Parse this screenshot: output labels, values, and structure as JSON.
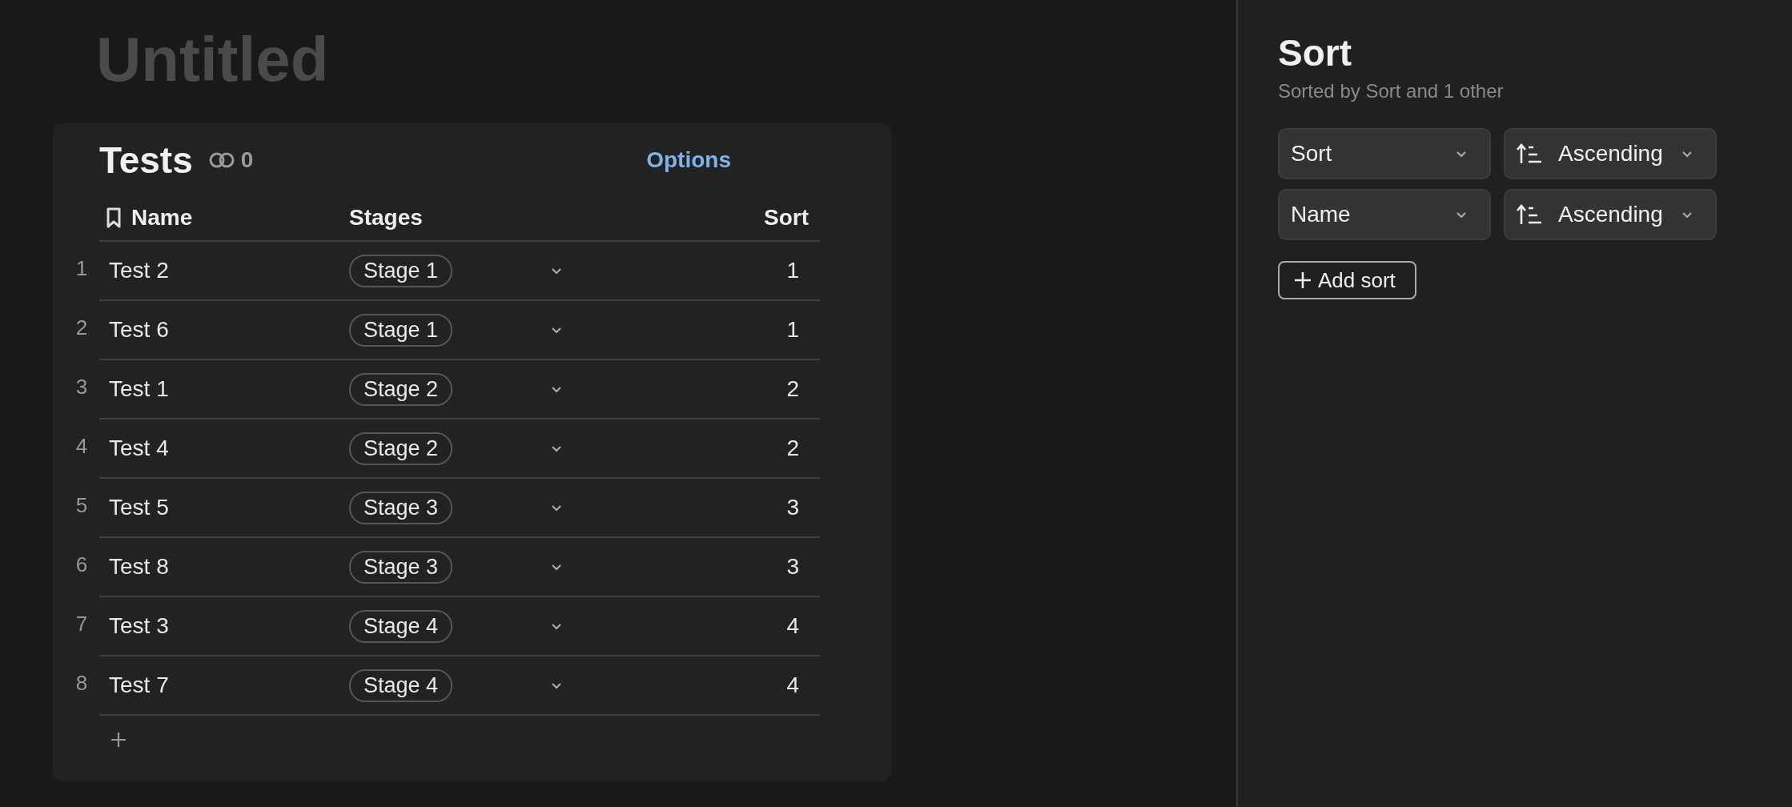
{
  "page": {
    "title": "Untitled"
  },
  "table": {
    "title": "Tests",
    "link_count": "0",
    "options": "Options",
    "columns": [
      "Name",
      "Stages",
      "Sort"
    ],
    "rows": [
      {
        "number": "1",
        "name": "Test 2",
        "stage": "Stage 1",
        "sort": "1"
      },
      {
        "number": "2",
        "name": "Test 6",
        "stage": "Stage 1",
        "sort": "1"
      },
      {
        "number": "3",
        "name": "Test 1",
        "stage": "Stage 2",
        "sort": "2"
      },
      {
        "number": "4",
        "name": "Test 4",
        "stage": "Stage 2",
        "sort": "2"
      },
      {
        "number": "5",
        "name": "Test 5",
        "stage": "Stage 3",
        "sort": "3"
      },
      {
        "number": "6",
        "name": "Test 8",
        "stage": "Stage 3",
        "sort": "3"
      },
      {
        "number": "7",
        "name": "Test 3",
        "stage": "Stage 4",
        "sort": "4"
      },
      {
        "number": "8",
        "name": "Test 7",
        "stage": "Stage 4",
        "sort": "4"
      }
    ]
  },
  "sort_panel": {
    "title": "Sort",
    "subtitle": "Sorted by Sort and 1 other",
    "sorts": [
      {
        "field": "Sort",
        "direction": "Ascending"
      },
      {
        "field": "Name",
        "direction": "Ascending"
      }
    ],
    "add_button": "Add sort"
  }
}
